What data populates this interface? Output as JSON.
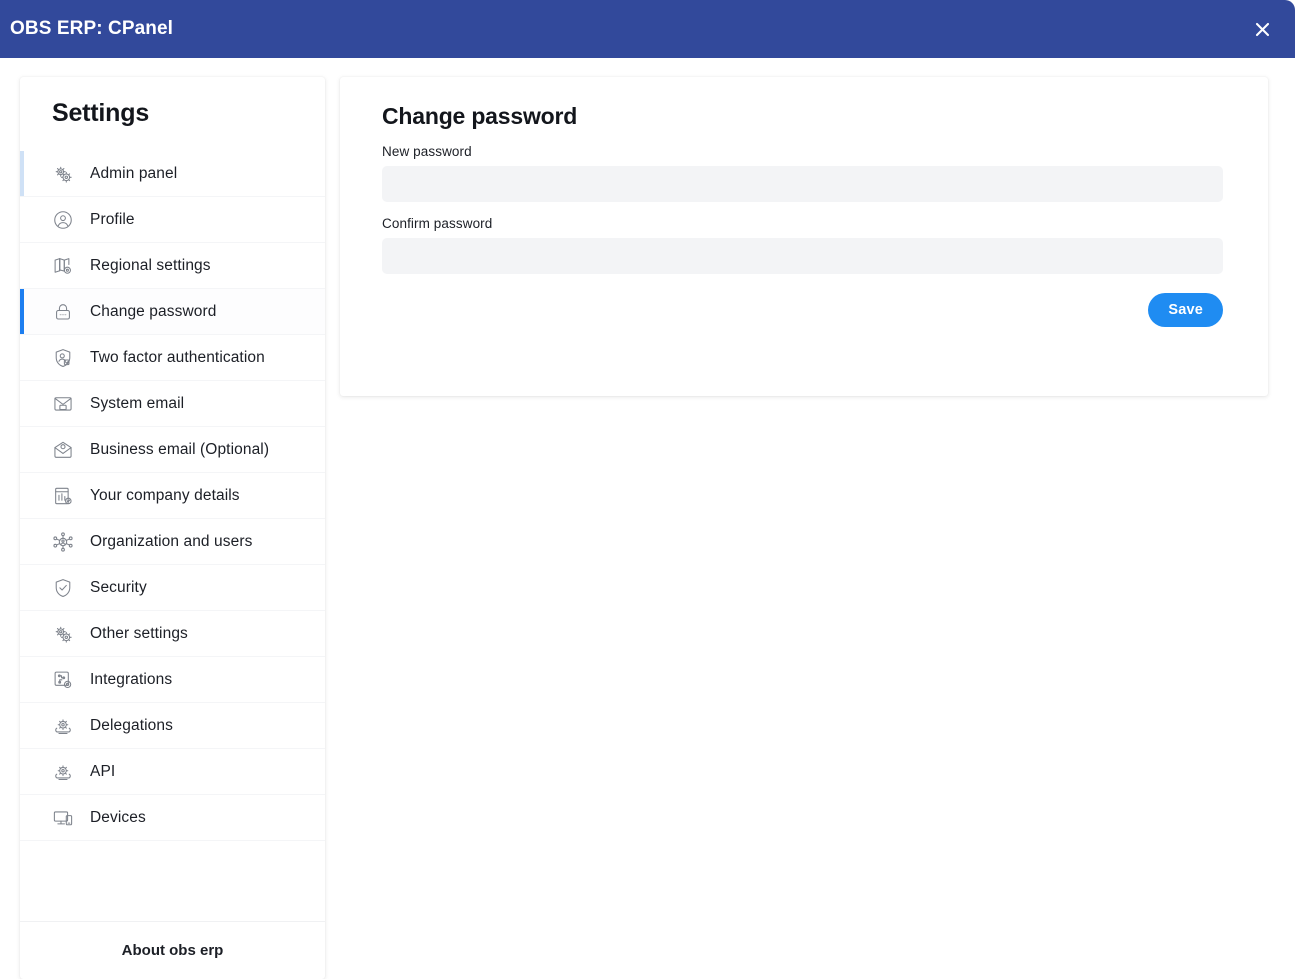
{
  "window": {
    "title": "OBS ERP: CPanel",
    "close_label": "Close",
    "titlebar_color": "#32499b"
  },
  "sidebar": {
    "title": "Settings",
    "footer_label": "About obs erp",
    "active_accent_color": "#1d7ef0",
    "hover_accent_color": "#cfe1f6",
    "items": [
      {
        "label": "Admin panel",
        "icon": "gears-icon",
        "state": "hovered"
      },
      {
        "label": "Profile",
        "icon": "user-circle-icon",
        "state": "default"
      },
      {
        "label": "Regional settings",
        "icon": "map-gear-icon",
        "state": "default"
      },
      {
        "label": "Change password",
        "icon": "lock-icon",
        "state": "active"
      },
      {
        "label": "Two factor authentication",
        "icon": "shield-user-icon",
        "state": "default"
      },
      {
        "label": "System email",
        "icon": "envelope-screen-icon",
        "state": "default"
      },
      {
        "label": "Business email (Optional)",
        "icon": "envelope-open-icon",
        "state": "default"
      },
      {
        "label": "Your company details",
        "icon": "building-icon",
        "state": "default"
      },
      {
        "label": "Organization and users",
        "icon": "network-users-icon",
        "state": "default"
      },
      {
        "label": "Security",
        "icon": "shield-check-icon",
        "state": "default"
      },
      {
        "label": "Other settings",
        "icon": "gears-icon",
        "state": "default"
      },
      {
        "label": "Integrations",
        "icon": "puzzle-gear-icon",
        "state": "default"
      },
      {
        "label": "Delegations",
        "icon": "cloud-gear-icon",
        "state": "default"
      },
      {
        "label": "API",
        "icon": "cloud-gear-icon",
        "state": "default"
      },
      {
        "label": "Devices",
        "icon": "monitor-icon",
        "state": "default"
      }
    ]
  },
  "main": {
    "title": "Change password",
    "fields": [
      {
        "label": "New password",
        "value": "",
        "placeholder": ""
      },
      {
        "label": "Confirm password",
        "value": "",
        "placeholder": ""
      }
    ],
    "save_label": "Save",
    "save_color": "#1f8cf2"
  }
}
